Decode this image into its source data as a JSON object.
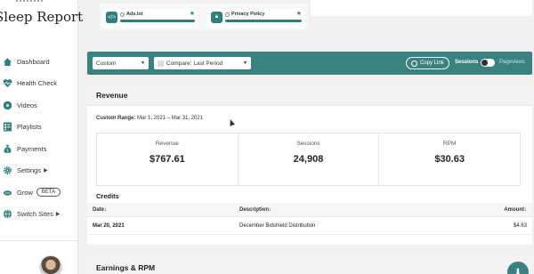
{
  "brand": {
    "title": "Sleep Report"
  },
  "sidebar": {
    "items": [
      {
        "label": "Dashboard",
        "icon": "home-icon"
      },
      {
        "label": "Health Check",
        "icon": "heartbeat-icon"
      },
      {
        "label": "Videos",
        "icon": "play-icon"
      },
      {
        "label": "Playlists",
        "icon": "playlist-icon"
      },
      {
        "label": "Payments",
        "icon": "money-bag-icon"
      },
      {
        "label": "Settings",
        "icon": "gear-icon"
      },
      {
        "label": "Grow",
        "icon": "grow-icon",
        "badge": "BETA"
      },
      {
        "label": "Switch Sites",
        "icon": "globe-icon"
      }
    ]
  },
  "top_cards": [
    {
      "title": "Ads.txt",
      "icon": "code-icon"
    },
    {
      "title": "Privacy Policy",
      "icon": "lock-icon"
    }
  ],
  "filters": {
    "range": "Custom",
    "compare": "Compare: Last Period",
    "copy_link": "Copy Link",
    "sessions": "Sessions",
    "pageviews": "Pageviews"
  },
  "revenue": {
    "title": "Revenue",
    "range_label": "Custom Range:",
    "range_value": "Mar 1, 2021 – Mar 31, 2021",
    "metrics": [
      {
        "label": "Revenue",
        "value": "$767.61"
      },
      {
        "label": "Sessions",
        "value": "24,908"
      },
      {
        "label": "RPM",
        "value": "$30.63"
      }
    ],
    "credits_title": "Credits",
    "columns": {
      "date": "Date",
      "description": "Description",
      "amount": "Amount"
    },
    "rows": [
      {
        "date": "Mar 20, 2021",
        "description": "December Bidshield Distribution",
        "amount": "$4.63"
      }
    ]
  },
  "earnings": {
    "title": "Earnings & RPM"
  },
  "colors": {
    "accent": "#3a8280"
  }
}
